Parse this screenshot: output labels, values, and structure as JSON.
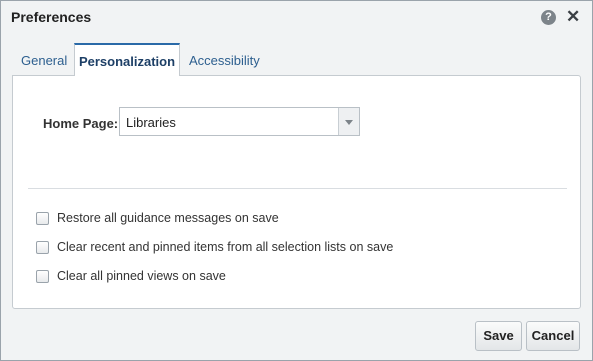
{
  "dialog": {
    "title": "Preferences",
    "help_glyph": "?",
    "close_glyph": "✕"
  },
  "tabs": [
    {
      "label": "General",
      "active": false
    },
    {
      "label": "Personalization",
      "active": true
    },
    {
      "label": "Accessibility",
      "active": false
    }
  ],
  "personalization": {
    "home_page_label": "Home Page:",
    "home_page_value": "Libraries",
    "options": [
      {
        "label": "Restore all guidance messages on save",
        "checked": false
      },
      {
        "label": "Clear recent and pinned items from all selection lists on save",
        "checked": false
      },
      {
        "label": "Clear all pinned views on save",
        "checked": false
      }
    ]
  },
  "footer": {
    "save_label": "Save",
    "cancel_label": "Cancel"
  },
  "colors": {
    "accent": "#2a6aa8",
    "tab_text": "#2d5f8f",
    "background": "#f1f3f4"
  }
}
